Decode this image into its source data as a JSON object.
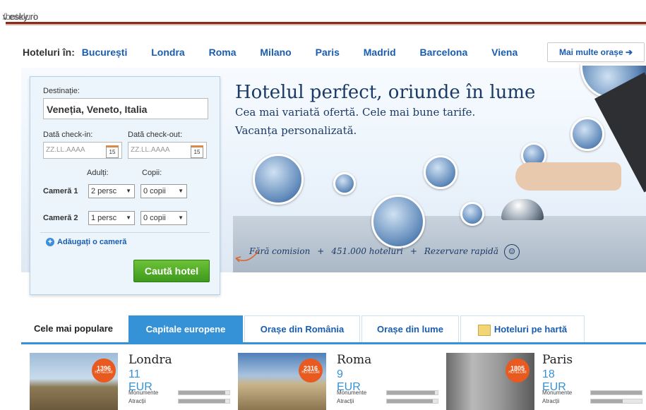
{
  "address_bar": {
    "domain": "v.esky.ro",
    "path": "/hoteluri"
  },
  "cities_nav": {
    "label": "Hoteluri în:",
    "items": [
      "București",
      "Londra",
      "Roma",
      "Milano",
      "Paris",
      "Madrid",
      "Barcelona",
      "Viena"
    ],
    "more_label": "Mai multe orașe ➔"
  },
  "search": {
    "destination_label": "Destinație:",
    "destination_value": "Veneția, Veneto, Italia",
    "checkin_label": "Dată check-in:",
    "checkout_label": "Dată check-out:",
    "date_placeholder": "ZZ.LL.AAAA",
    "calendar_day": "15",
    "adults_label": "Adulți:",
    "children_label": "Copii:",
    "rooms": [
      {
        "label": "Cameră 1",
        "adults": "2 persc",
        "children": "0 copii"
      },
      {
        "label": "Cameră 2",
        "adults": "1 persc",
        "children": "0 copii"
      }
    ],
    "add_room": "Adăugați o cameră",
    "submit": "Caută hotel"
  },
  "hero": {
    "headline": "Hotelul perfect, oriunde în lume",
    "line1": "Cea mai variată ofertă. Cele mai bune tarife.",
    "line2": "Vacanța personalizată.",
    "tagline": {
      "a": "Fără comision",
      "b": "451.000 hoteluri",
      "c": "Rezervare rapidă",
      "sep": "+"
    }
  },
  "tabs": [
    {
      "label": "Cele mai populare"
    },
    {
      "label": "Capitale europene"
    },
    {
      "label": "Orașe din România"
    },
    {
      "label": "Orașe din lume"
    },
    {
      "label": "Hoteluri pe hartă"
    }
  ],
  "cards": [
    {
      "city": "Londra",
      "price": "11 EUR",
      "count": "1396",
      "badge_sub": "HOTELURI",
      "r1": "Monumente",
      "r2": "Atracții",
      "v1": 0.92,
      "v2": 0.92
    },
    {
      "city": "Roma",
      "price": "9 EUR",
      "count": "2316",
      "badge_sub": "HOTELURI",
      "r1": "Monumente",
      "r2": "Atracții",
      "v1": 0.95,
      "v2": 0.9
    },
    {
      "city": "Paris",
      "price": "18 EUR",
      "count": "1805",
      "badge_sub": "HOTELURI",
      "r1": "Monumente",
      "r2": "Atracții",
      "v1": 1.0,
      "v2": 0.62
    }
  ],
  "colors": {
    "link": "#1a5db0",
    "accent": "#3592d7",
    "cta": "#4ea924",
    "badge": "#e85a20"
  }
}
